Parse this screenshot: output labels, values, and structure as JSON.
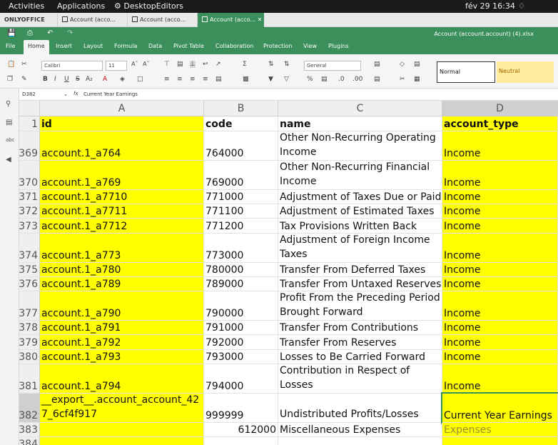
{
  "system": {
    "activities": "Activities",
    "applications": "Applications",
    "app_name": "DesktopEditors",
    "clock": "fév 29  16:34"
  },
  "tabs": {
    "brand": "ONLYOFFICE",
    "items": [
      "Account (acco...",
      "Account (acco...",
      "Account (acco..."
    ]
  },
  "window": {
    "title": "Account (account.account) (4).xlsx"
  },
  "menu": {
    "file": "File",
    "items": [
      "Home",
      "Insert",
      "Layout",
      "Formula",
      "Data",
      "Pivot Table",
      "Collaboration",
      "Protection",
      "View",
      "Plugins"
    ]
  },
  "ribbon": {
    "font_name": "Calibri",
    "font_size": "11",
    "number_format": "General",
    "style_normal": "Normal",
    "style_neutral": "Neutral"
  },
  "formula": {
    "cell_ref": "D382",
    "fx": "fx",
    "value": "Current Year Earnings"
  },
  "grid": {
    "columns": [
      "A",
      "B",
      "C",
      "D"
    ],
    "header_row": {
      "num": "1",
      "id": "id",
      "code": "code",
      "name": "name",
      "account_type": "account_type"
    },
    "rows": [
      {
        "num": "369",
        "id": "account.1_a764",
        "code": "764000",
        "name": "Other Non-Recurring Operating Income",
        "type": "Income"
      },
      {
        "num": "370",
        "id": "account.1_a769",
        "code": "769000",
        "name": "Other Non-Recurring Financial Income",
        "type": "Income"
      },
      {
        "num": "371",
        "id": "account.1_a7710",
        "code": "771000",
        "name": "Adjustment of Taxes Due or Paid",
        "type": "Income"
      },
      {
        "num": "372",
        "id": "account.1_a7711",
        "code": "771100",
        "name": "Adjustment of Estimated Taxes",
        "type": "Income"
      },
      {
        "num": "373",
        "id": "account.1_a7712",
        "code": "771200",
        "name": "Tax Provisions Written Back",
        "type": "Income"
      },
      {
        "num": "374",
        "id": "account.1_a773",
        "code": "773000",
        "name": "Adjustment of Foreign Income Taxes",
        "type": "Income"
      },
      {
        "num": "375",
        "id": "account.1_a780",
        "code": "780000",
        "name": "Transfer From Deferred Taxes",
        "type": "Income"
      },
      {
        "num": "376",
        "id": "account.1_a789",
        "code": "789000",
        "name": "Transfer From Untaxed Reserves",
        "type": "Income"
      },
      {
        "num": "377",
        "id": "account.1_a790",
        "code": "790000",
        "name": "Profit From the Preceding Period Brought Forward",
        "type": "Income"
      },
      {
        "num": "378",
        "id": "account.1_a791",
        "code": "791000",
        "name": "Transfer From Contributions",
        "type": "Income"
      },
      {
        "num": "379",
        "id": "account.1_a792",
        "code": "792000",
        "name": "Transfer From Reserves",
        "type": "Income"
      },
      {
        "num": "380",
        "id": "account.1_a793",
        "code": "793000",
        "name": "Losses to Be Carried Forward",
        "type": "Income"
      },
      {
        "num": "381",
        "id": "account.1_a794",
        "code": "794000",
        "name": "Shareholders' (or Owners') Contribution in Respect of Losses",
        "type": "Income"
      },
      {
        "num": "382",
        "id": "__export__.account_account_427_6cf4f917",
        "code": "999999",
        "name": "Undistributed Profits/Losses",
        "type": "Current Year Earnings"
      },
      {
        "num": "383",
        "id": "",
        "code": "612000",
        "name": "Miscellaneous Expenses",
        "type": "Expenses"
      },
      {
        "num": "384",
        "id": "",
        "code": "",
        "name": "",
        "type": ""
      }
    ]
  }
}
